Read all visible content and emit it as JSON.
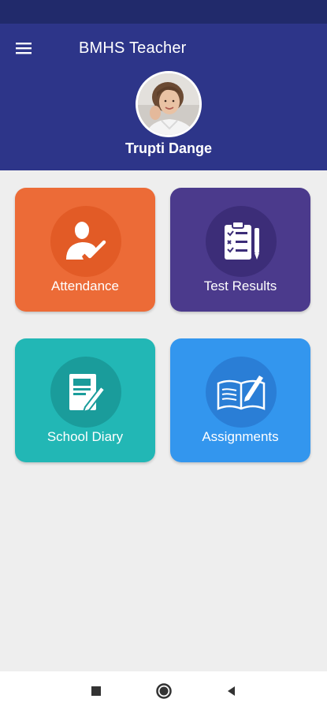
{
  "header": {
    "title": "BMHS Teacher",
    "menu_icon": "hamburger-menu-icon",
    "user_name": "Trupti Dange"
  },
  "tiles": [
    {
      "label": "Attendance",
      "icon": "attendance-person-check-icon",
      "color": "#ec6b37",
      "circle_color": "#e25b26"
    },
    {
      "label": "Test Results",
      "icon": "clipboard-checklist-icon",
      "color": "#4b3a8c",
      "circle_color": "#3c2d78"
    },
    {
      "label": "School Diary",
      "icon": "notebook-pencil-icon",
      "color": "#22b7b5",
      "circle_color": "#1a9c9b"
    },
    {
      "label": "Assignments",
      "icon": "open-book-pen-icon",
      "color": "#3396ee",
      "circle_color": "#2a7ed6"
    }
  ],
  "colors": {
    "status_bar": "#212a6b",
    "header": "#2d3589",
    "background": "#eeeeee"
  },
  "system_nav": {
    "recents_icon": "square-recents-icon",
    "home_icon": "circle-home-icon",
    "back_icon": "triangle-back-icon"
  }
}
